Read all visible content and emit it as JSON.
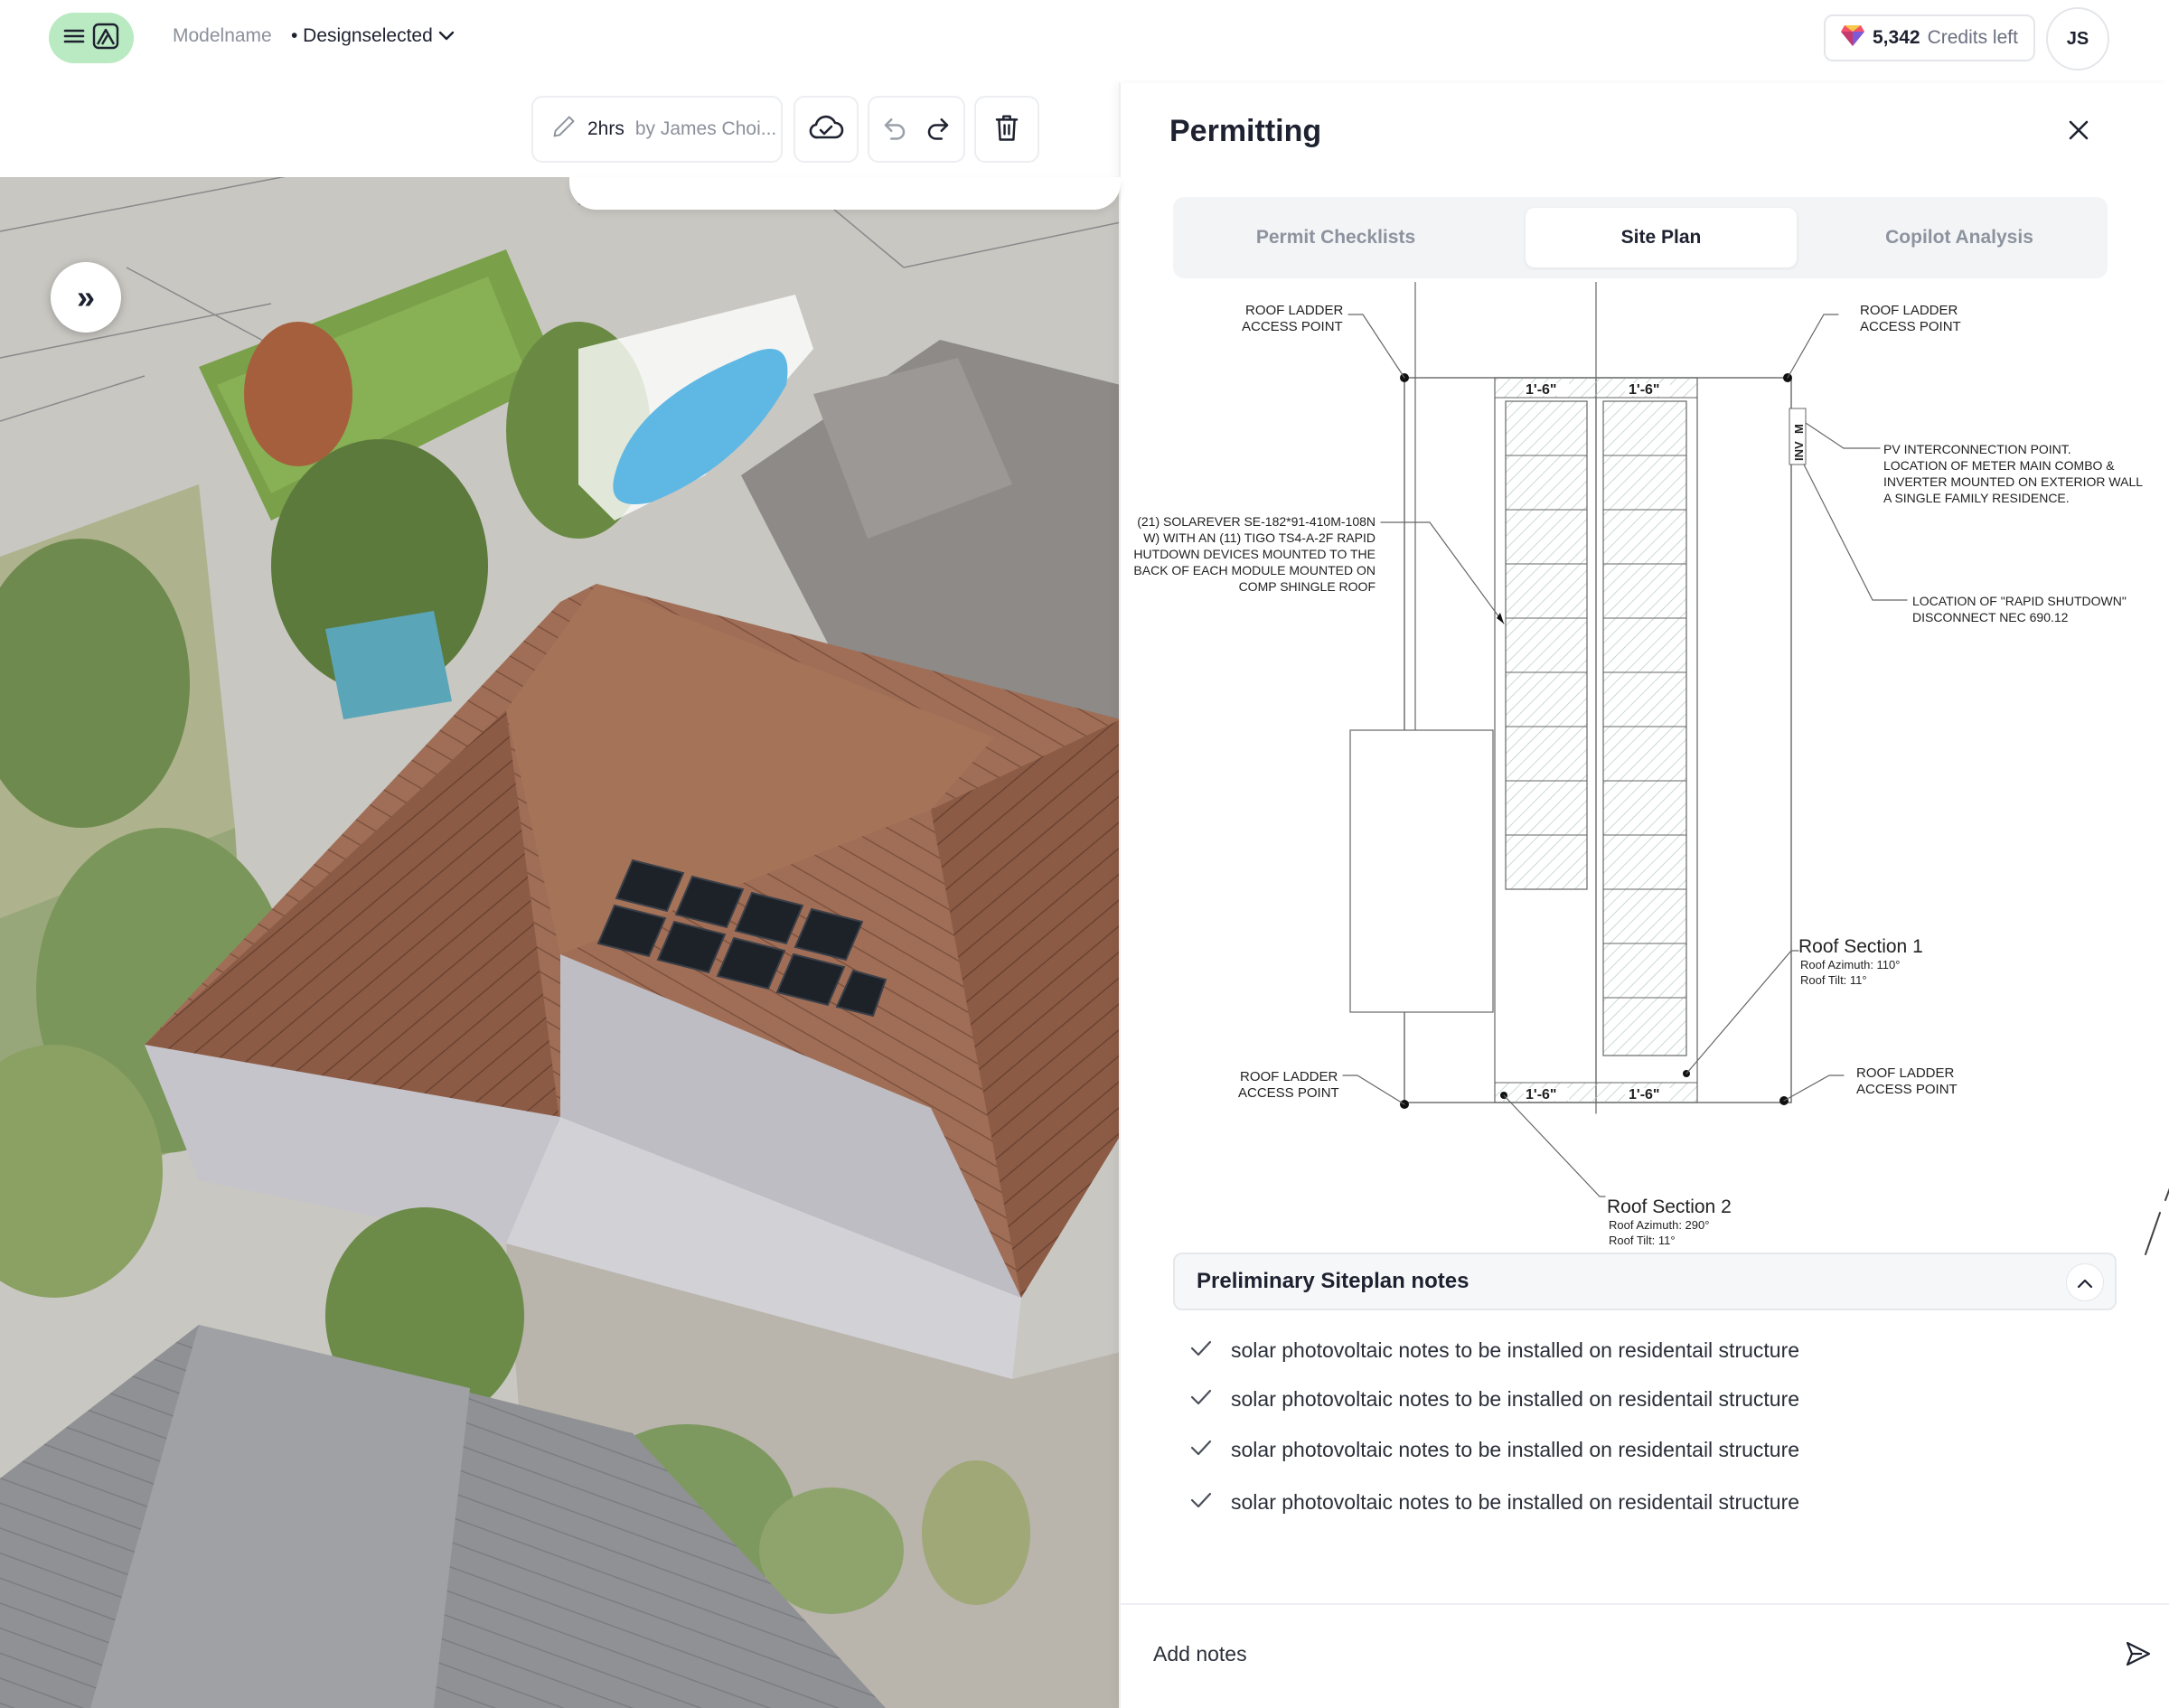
{
  "topbar": {
    "model_name": "Modelname",
    "design_selected": "• Designselected",
    "credits_count": "5,342",
    "credits_suffix": "Credits left",
    "avatar_initials": "JS"
  },
  "toolbar": {
    "history_time": "2hrs",
    "history_author": "by James Choi..."
  },
  "panel": {
    "title": "Permitting",
    "tabs": [
      {
        "label": "Permit Checklists",
        "active": false
      },
      {
        "label": "Site Plan",
        "active": true
      },
      {
        "label": "Copilot Analysis",
        "active": false
      }
    ]
  },
  "siteplan": {
    "ladder_top_left": [
      "ROOF LADDER",
      "ACCESS POINT"
    ],
    "ladder_top_right": [
      "ROOF LADDER",
      "ACCESS POINT"
    ],
    "ladder_bottom_left": [
      "ROOF LADDER",
      "ACCESS POINT"
    ],
    "ladder_bottom_right": [
      "ROOF LADDER",
      "ACCESS POINT"
    ],
    "dim_label": "1'-6\"",
    "module_note": [
      "(21) SOLAREVER SE-182*91-410M-108N",
      "W) WITH AN (11) TIGO TS4-A-2F RAPID",
      "HUTDOWN DEVICES MOUNTED TO THE",
      "BACK OF EACH MODULE MOUNTED ON",
      "COMP SHINGLE ROOF"
    ],
    "pv_note": [
      "PV INTERCONNECTION POINT.",
      "LOCATION OF METER MAIN COMBO &",
      "INVERTER MOUNTED ON EXTERIOR  WALL",
      "A SINGLE FAMILY RESIDENCE."
    ],
    "rsd_note": [
      "LOCATION OF \"RAPID SHUTDOWN\"",
      "DISCONNECT NEC 690.12"
    ],
    "inv_label": "INV",
    "m_label": "M",
    "section1": {
      "title": "Roof Section 1",
      "azimuth": "Roof Azimuth: 110°",
      "tilt": "Roof Tilt: 11°"
    },
    "section2": {
      "title": "Roof Section 2",
      "azimuth": "Roof Azimuth: 290°",
      "tilt": "Roof Tilt: 11°"
    }
  },
  "notes": {
    "header": "Preliminary Siteplan notes",
    "items": [
      "solar photovoltaic notes to be installed on residentail structure",
      "solar photovoltaic notes to be installed on residentail structure",
      "solar photovoltaic notes to be installed on residentail structure",
      "solar photovoltaic notes to be installed on residentail structure"
    ],
    "input_placeholder": "Add notes"
  },
  "colors": {
    "accent_green": "#b9eac1",
    "text_dark": "#1e2230",
    "text_muted": "#8b909b"
  }
}
